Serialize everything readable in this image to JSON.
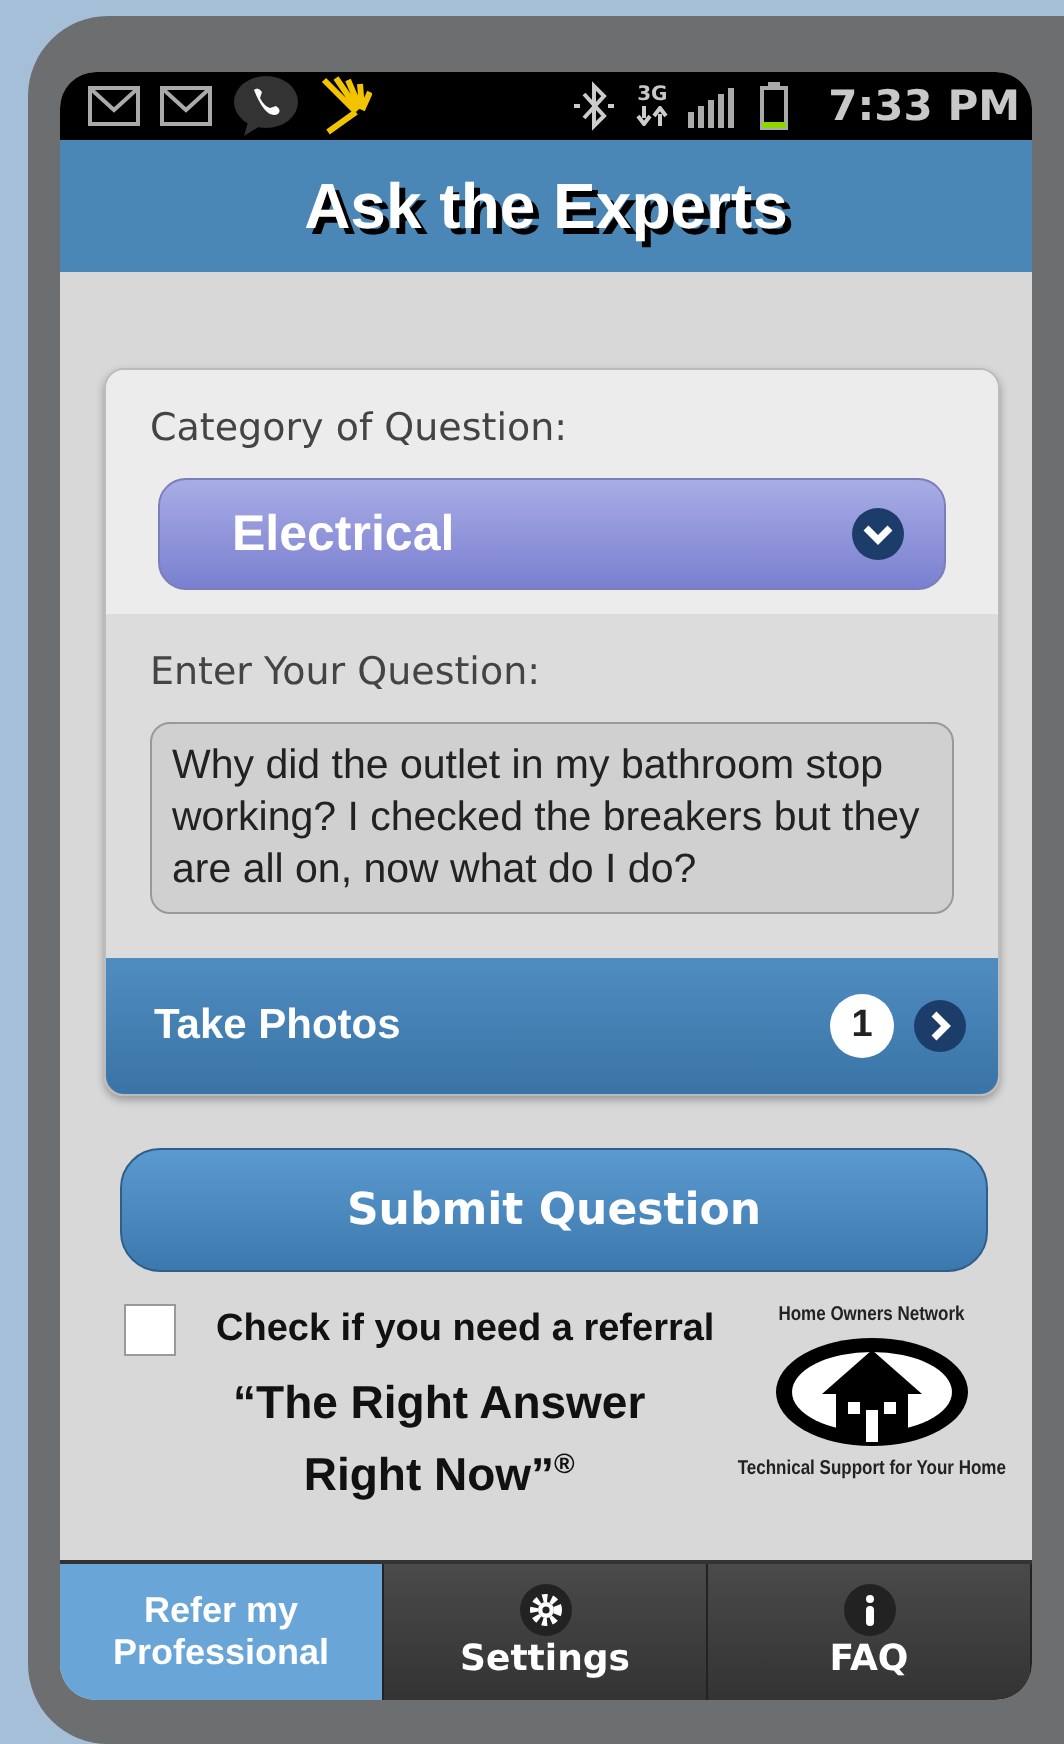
{
  "status_bar": {
    "network": "3G",
    "time": "7:33 PM"
  },
  "header": {
    "title": "Ask the Experts"
  },
  "form": {
    "category_label": "Category of Question:",
    "category_value": "Electrical",
    "question_label": "Enter Your Question:",
    "question_value": "Why did the outlet in my bathroom stop working?  I checked the breakers but they are all on, now what do I do?",
    "photos": {
      "label": "Take Photos",
      "count": "1"
    },
    "submit": "Submit Question",
    "referral": {
      "label": "Check if you need a referral",
      "checked": false
    }
  },
  "slogan": [
    "“The Right Answer",
    "Right Now”$^{®}$"
  ],
  "logo": {
    "top_text": "Home Owners Network",
    "bottom_text": "Technical Support for Your Home"
  },
  "tabs": [
    {
      "label": "Refer my Professional",
      "kind": "text",
      "selected": true
    },
    {
      "label": "Settings",
      "kind": "gear",
      "selected": false
    },
    {
      "label": "FAQ",
      "kind": "info",
      "selected": false
    }
  ]
}
